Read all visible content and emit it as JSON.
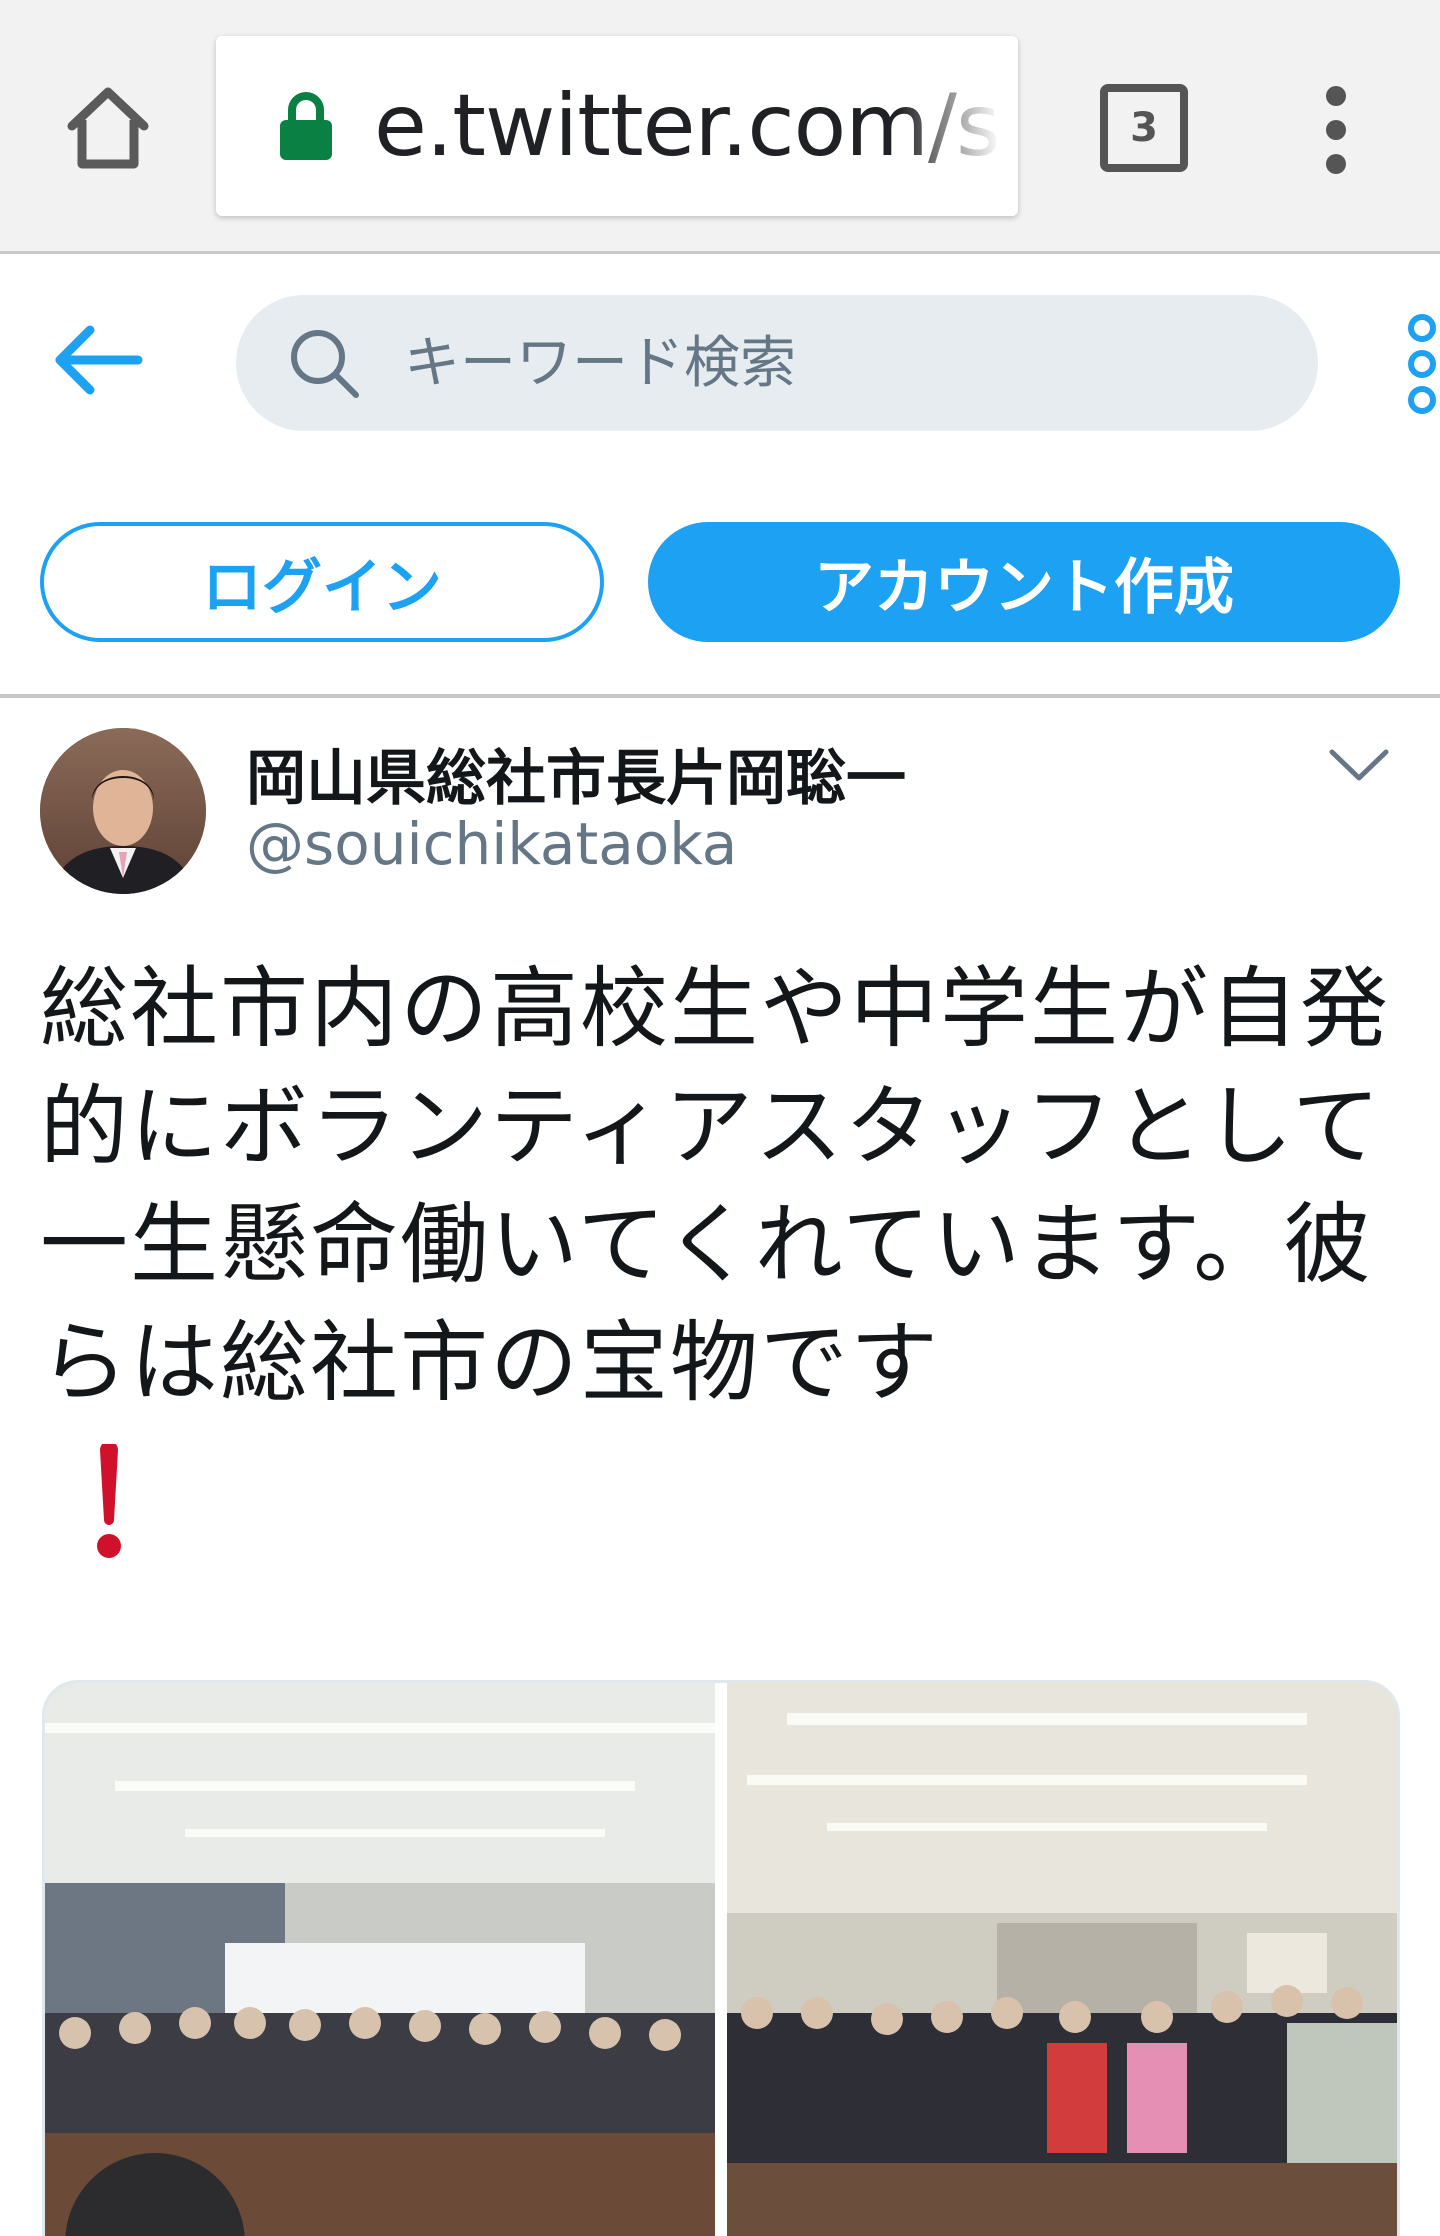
{
  "browser": {
    "url": "e.twitter.com/s",
    "tab_count": "3",
    "icons": [
      "home-icon",
      "lock-icon",
      "tabs-icon",
      "overflow-menu-icon"
    ]
  },
  "header": {
    "search_placeholder": "キーワード検索",
    "icons": [
      "back-arrow-icon",
      "search-icon",
      "more-icon"
    ]
  },
  "actions": {
    "login_label": "ログイン",
    "signup_label": "アカウント作成"
  },
  "tweet": {
    "author_name": "岡山県総社市長片岡聡一",
    "author_handle": "@souichikataoka",
    "text": "総社市内の高校生や中学生が自発的にボランティアスタッフとして一生懸命働いてくれています。彼らは総社市の宝物です",
    "emoji": "exclamation-emoji",
    "photo_count": 2
  },
  "colors": {
    "brand": "#1da1f2",
    "secure_lock": "#0b8043",
    "exclamation": "#d0112b",
    "search_bg": "#e6ecf0"
  }
}
